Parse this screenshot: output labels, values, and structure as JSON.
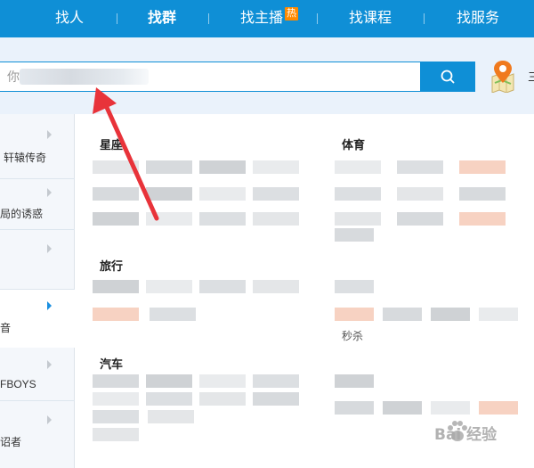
{
  "nav": {
    "items": [
      {
        "label": "找人"
      },
      {
        "label": "找群"
      },
      {
        "label": "找主播",
        "badge": "热"
      },
      {
        "label": "找课程"
      },
      {
        "label": "找服务"
      }
    ]
  },
  "search": {
    "value": "你",
    "cut_text": "三"
  },
  "sidebar": {
    "items": [
      {
        "label": "轩辕传奇",
        "active": false
      },
      {
        "label": "局的诱惑",
        "active": false
      },
      {
        "label": "",
        "active": false
      },
      {
        "label": "音",
        "active": true
      },
      {
        "label": "FBOYS",
        "active": false
      },
      {
        "label": "诏者",
        "active": false
      }
    ]
  },
  "categories": {
    "xingzuo": "星座",
    "tiyu": "体育",
    "lvxing": "旅行",
    "qiche": "汽车"
  },
  "labels": {
    "miaosha": "秒杀"
  },
  "watermark": {
    "text": "Bai  经验"
  },
  "colors": {
    "nav_bg": "#0f8fd6",
    "search_bg": "#eaf2fb",
    "arrow": "#e8333a",
    "badge": "#ff8a00"
  }
}
